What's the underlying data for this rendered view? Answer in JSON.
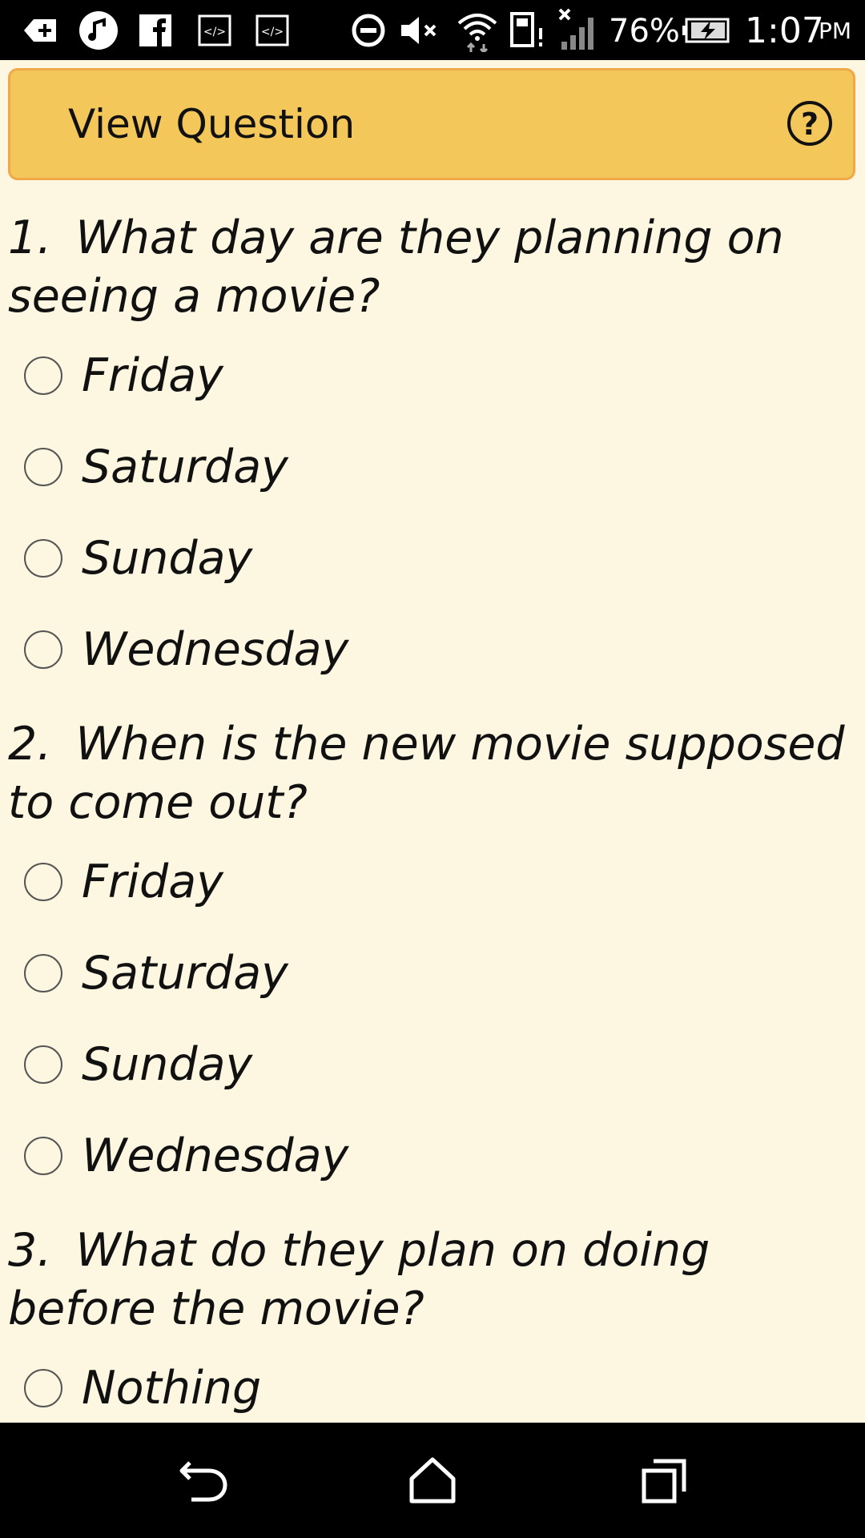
{
  "status_bar": {
    "battery_percent": "76%",
    "time": "1:07",
    "ampm": "PM",
    "icons": [
      "add-box-icon",
      "music-app-icon",
      "facebook-icon",
      "code-icon",
      "code-icon",
      "do-not-disturb-icon",
      "volume-muted-icon",
      "wifi-icon",
      "sd-card-alert-icon",
      "no-signal-icon",
      "battery-charging-icon"
    ]
  },
  "header": {
    "title": "View Question",
    "help_label": "?"
  },
  "questions": [
    {
      "number": "1.",
      "text": "What day are they planning on seeing a movie?",
      "options": [
        "Friday",
        "Saturday",
        "Sunday",
        "Wednesday"
      ]
    },
    {
      "number": "2.",
      "text": "When is the new movie supposed to come out?",
      "options": [
        "Friday",
        "Saturday",
        "Sunday",
        "Wednesday"
      ]
    },
    {
      "number": "3.",
      "text": "What do they plan on doing before the movie?",
      "options": [
        "Nothing"
      ]
    }
  ],
  "nav": {
    "icons": [
      "back-icon",
      "home-icon",
      "recents-icon"
    ]
  },
  "colors": {
    "header_bg": "#f3c75a",
    "header_border": "#f0a848",
    "page_bg": "#fdf6e0",
    "bars": "#000000"
  }
}
